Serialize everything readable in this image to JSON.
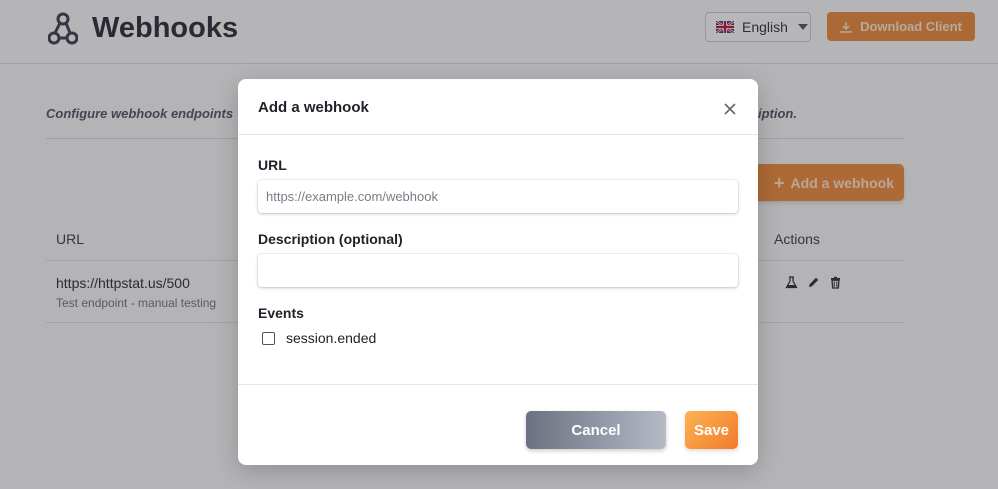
{
  "header": {
    "title": "Webhooks",
    "language": "English",
    "download_label": "Download Client"
  },
  "main": {
    "intro_start": "Configure webhook endpoints",
    "intro_end": "iption.",
    "add_button_label": "Add a webhook",
    "columns": {
      "url": "URL",
      "actions": "Actions"
    },
    "rows": [
      {
        "url": "https://httpstat.us/500",
        "description": "Test endpoint - manual testing"
      }
    ]
  },
  "modal": {
    "title": "Add a webhook",
    "url_label": "URL",
    "url_placeholder": "https://example.com/webhook",
    "url_value": "",
    "description_label": "Description (optional)",
    "description_value": "",
    "events_label": "Events",
    "events": [
      {
        "name": "session.ended",
        "checked": false
      }
    ],
    "cancel_label": "Cancel",
    "save_label": "Save"
  },
  "colors": {
    "accent": "#ec8a3a",
    "save_gradient_start": "#fbb352",
    "save_gradient_end": "#f27a2c",
    "cancel_gradient_start": "#6c7080",
    "cancel_gradient_end": "#b5bac7"
  },
  "icons": {
    "logo": "webhook-logo-icon",
    "flag": "uk-flag-icon",
    "download": "download-icon",
    "add": "plus-icon",
    "test": "flask-icon",
    "edit": "pencil-icon",
    "delete": "trash-icon",
    "close": "close-icon"
  }
}
